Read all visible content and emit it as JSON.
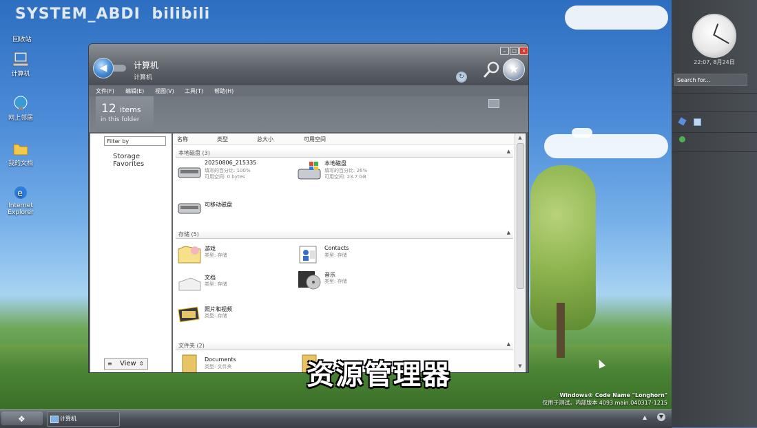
{
  "watermark": {
    "user": "SYSTEM_ABDI",
    "site": "bilibili"
  },
  "desktop_icons": [
    {
      "label": "回收站"
    },
    {
      "label": "计算机"
    },
    {
      "label": "网上邻居"
    },
    {
      "label": "我的文档"
    },
    {
      "label": "Internet Explorer"
    }
  ],
  "window": {
    "title": "计算机",
    "subtitle": "计算机",
    "menu": [
      "文件(F)",
      "编辑(E)",
      "视图(V)",
      "工具(T)",
      "帮助(H)"
    ],
    "info": {
      "count": "12",
      "count_unit": "items",
      "location": "in this folder"
    },
    "left_pane": {
      "filter_placeholder": "Filter by",
      "favorites": "Storage Favorites",
      "view_label": "View"
    },
    "columns": [
      "名称",
      "类型",
      "总大小",
      "可用空间"
    ],
    "groups": [
      {
        "title": "本地磁盘 (3)"
      },
      {
        "title": "存储 (5)"
      },
      {
        "title": "文件夹 (2)"
      }
    ],
    "drives": [
      {
        "name": "20250806_215335",
        "d1": "填写的百分比: 100%",
        "d2": "可用空间: 0 bytes"
      },
      {
        "name": "本地磁盘",
        "d1": "填写的百分比: 26%",
        "d2": "可用空间: 23.7 GB"
      },
      {
        "name": "可移动磁盘",
        "d1": "",
        "d2": ""
      }
    ],
    "storage": [
      {
        "name": "游戏",
        "d1": "类型: 存储"
      },
      {
        "name": "Contacts",
        "d1": "类型: 存储"
      },
      {
        "name": "文档",
        "d1": "类型: 存储"
      },
      {
        "name": "音乐",
        "d1": "类型: 存储"
      },
      {
        "name": "照片和视频",
        "d1": "类型: 存储"
      }
    ],
    "folders": [
      {
        "name": "Documents",
        "d1": "类型: 文件夹"
      }
    ]
  },
  "sidebar": {
    "clock_text": "22:07, 8月24日",
    "search_placeholder": "Search for..."
  },
  "overlay_caption": "资源管理器",
  "branding": {
    "line1": "Windows® Code Name \"Longhorn\"",
    "line2": "仅用于测试。内部版本 4093.main.040317-1215"
  },
  "taskbar": {
    "task_label": "计算机"
  },
  "colors": {
    "accent_blue": "#4a8fd8",
    "window_chrome": "#5c6168",
    "sidebar": "#3b3f44"
  }
}
